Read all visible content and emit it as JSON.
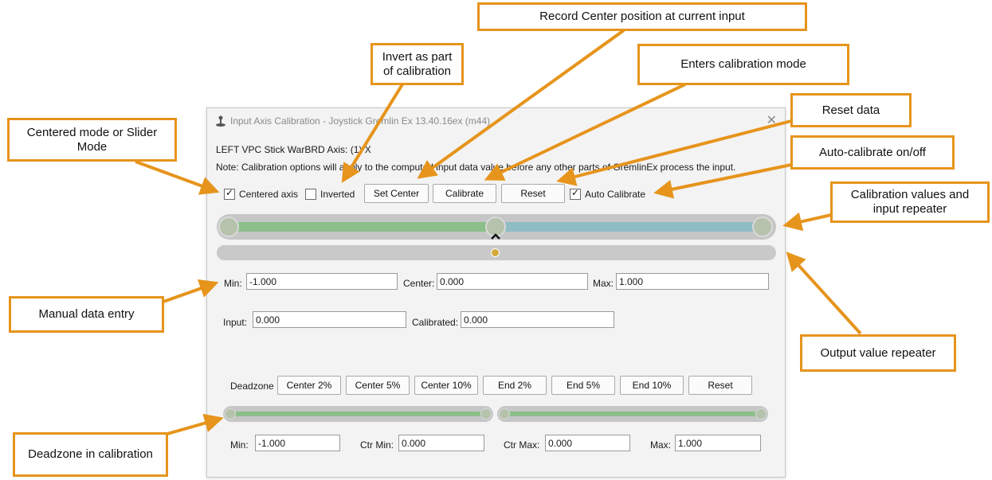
{
  "window": {
    "title": "Input Axis Calibration - Joystick Gremlin Ex 13.40.16ex (m44)",
    "close": "✕"
  },
  "device_line": "LEFT VPC Stick WarBRD Axis: (1) X",
  "note": "Note: Calibration options will apply to the computed input data value before any other parts of GremlinEx process the input.",
  "options": {
    "centered_axis": {
      "label": "Centered axis",
      "checked": true
    },
    "inverted": {
      "label": "Inverted",
      "checked": false
    },
    "set_center": "Set Center",
    "calibrate": "Calibrate",
    "reset": "Reset",
    "auto_calibrate": {
      "label": "Auto Calibrate",
      "checked": true
    }
  },
  "calibration_slider": {
    "min": -1.0,
    "center": 0.0,
    "max": 1.0,
    "current": 0.0
  },
  "output_slider": {
    "value": 0.0
  },
  "manual_entry": {
    "min_label": "Min:",
    "min_value": "-1.000",
    "center_label": "Center:",
    "center_value": "0.000",
    "max_label": "Max:",
    "max_value": "1.000"
  },
  "values": {
    "input_label": "Input:",
    "input_value": "0.000",
    "calibrated_label": "Calibrated:",
    "calibrated_value": "0.000"
  },
  "deadzone": {
    "label": "Deadzone",
    "buttons": [
      "Center 2%",
      "Center 5%",
      "Center 10%",
      "End 2%",
      "End 5%",
      "End 10%",
      "Reset"
    ],
    "min_label": "Min:",
    "min_value": "-1.000",
    "ctr_min_label": "Ctr Min:",
    "ctr_min_value": "0.000",
    "ctr_max_label": "Ctr Max:",
    "ctr_max_value": "0.000",
    "max_label": "Max:",
    "max_value": "1.000"
  },
  "callouts": {
    "record_center": "Record Center position at current input",
    "invert": "Invert as part of calibration",
    "enters_calibration": "Enters calibration mode",
    "reset_data": "Reset data",
    "centered_mode": "Centered mode or Slider Mode",
    "auto_calibrate": "Auto-calibrate on/off",
    "calibration_values": "Calibration values and input repeater",
    "manual_entry": "Manual data entry",
    "output_repeater": "Output value repeater",
    "deadzone_calibration": "Deadzone in calibration"
  },
  "colors": {
    "accent_orange": "#e6941c",
    "range_green": "#8cbf8a",
    "range_blue": "#8fbcc4",
    "output_marker": "#d4a83a"
  },
  "icons": {
    "app": "joystick-icon",
    "close": "close-icon",
    "center_marker": "caret-up-icon"
  }
}
